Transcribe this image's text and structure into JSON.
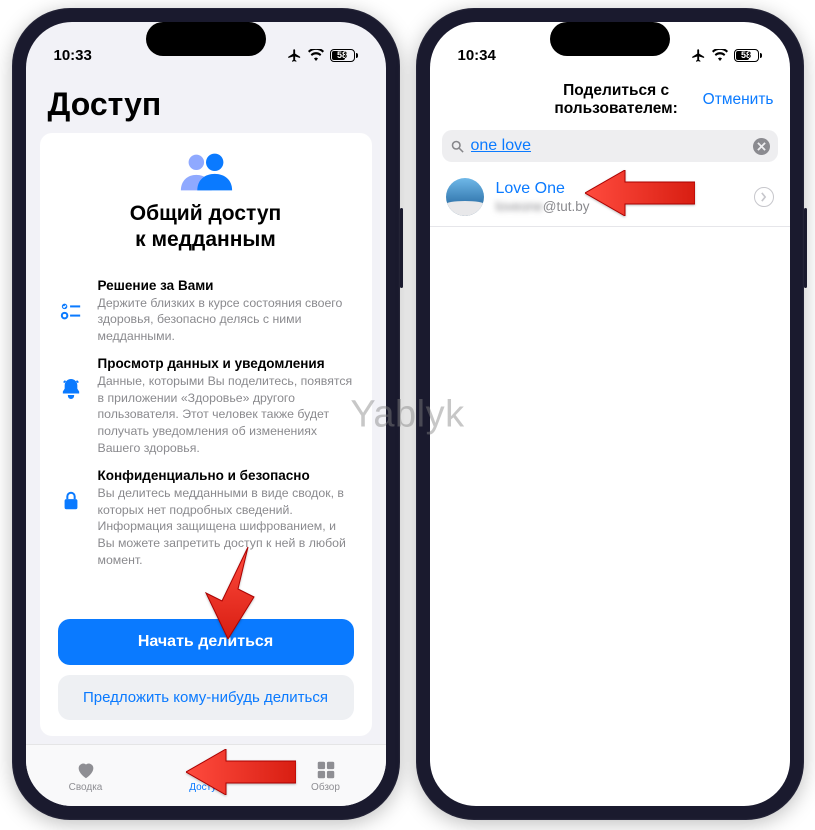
{
  "watermark": "Yablyk",
  "left": {
    "status": {
      "time": "10:33",
      "battery": "58"
    },
    "page_title": "Доступ",
    "card": {
      "heading_line1": "Общий доступ",
      "heading_line2": "к медданным",
      "features": [
        {
          "title": "Решение за Вами",
          "desc": "Держите близких в курсе состояния своего здоровья, безопасно делясь с ними медданными."
        },
        {
          "title": "Просмотр данных и уведомления",
          "desc": "Данные, которыми Вы поделитесь, появятся в приложении «Здоровье» другого пользователя. Этот человек также будет получать уведомления об изменениях Вашего здоровья."
        },
        {
          "title": "Конфиденциально и безопасно",
          "desc": "Вы делитесь медданными в виде сводок, в которых нет подробных сведений. Информация защищена шифрованием, и Вы можете запретить доступ к ней в любой момент."
        }
      ],
      "primary_button": "Начать делиться",
      "secondary_button": "Предложить кому-нибудь делиться"
    },
    "tabs": {
      "summary": "Сводка",
      "sharing": "Доступ",
      "browse": "Обзор"
    }
  },
  "right": {
    "status": {
      "time": "10:34",
      "battery": "58"
    },
    "nav": {
      "title": "Поделиться с пользователем:",
      "cancel": "Отменить"
    },
    "search": {
      "query": "one love"
    },
    "result": {
      "name": "Love One",
      "email_hidden": "loveone",
      "email_domain": "@tut.by"
    }
  }
}
